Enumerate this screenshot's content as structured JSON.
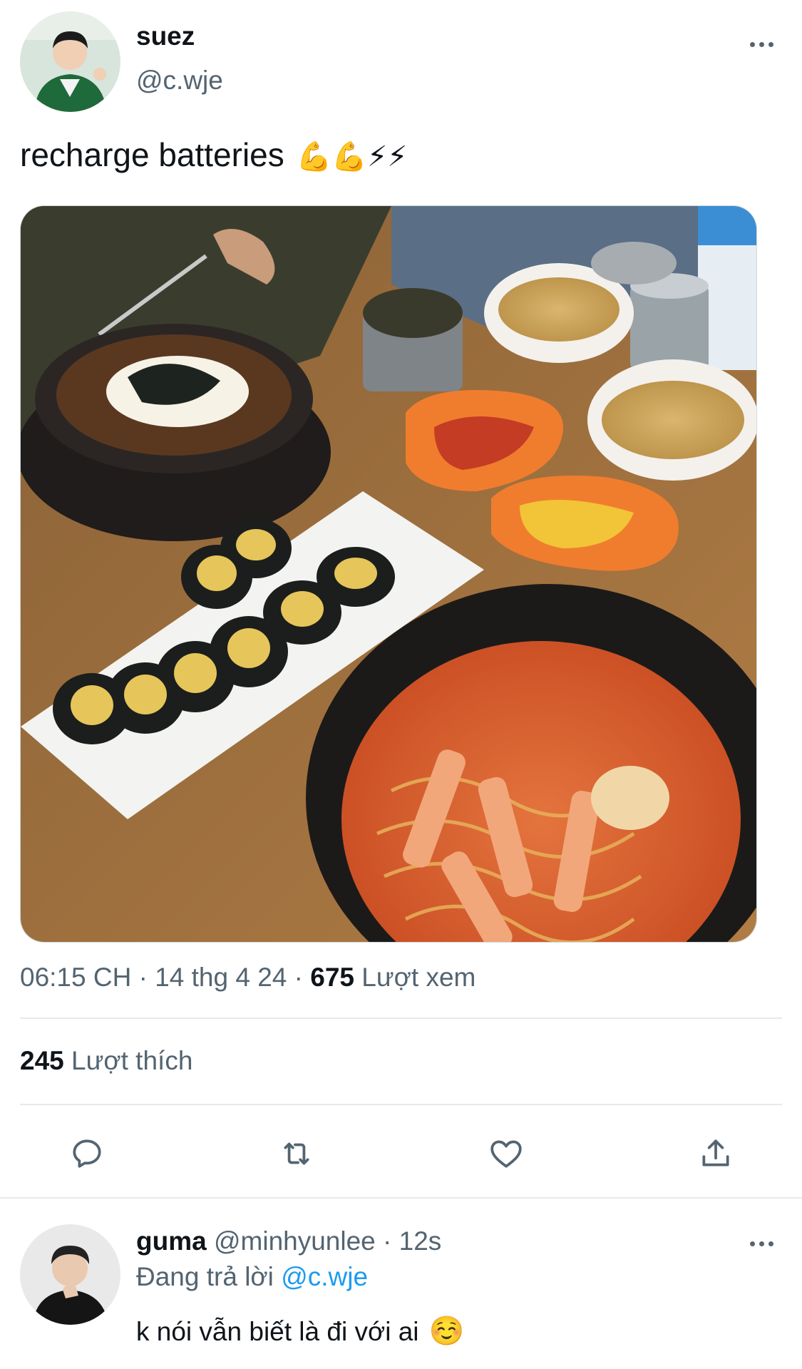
{
  "tweet": {
    "author_name": "suez",
    "author_handle": "@c.wje",
    "text": "recharge batteries",
    "text_emojis": "💪💪⚡⚡",
    "time": "06:15 CH",
    "sep": " · ",
    "date": "14 thg 4 24",
    "views_count": "675",
    "views_label": "Lượt xem",
    "likes_count": "245",
    "likes_label": "Lượt thích"
  },
  "actions": {
    "reply_icon": "reply-icon",
    "retweet_icon": "retweet-icon",
    "like_icon": "heart-icon",
    "share_icon": "share-icon"
  },
  "reply": {
    "author_name": "guma",
    "author_handle": "@minhyunlee",
    "time": "· 12s",
    "replying_label": "Đang trả lời",
    "replying_to": "@c.wje",
    "text": "k nói vẫn biết là đi với ai",
    "text_emoji": "☺️"
  },
  "colors": {
    "text_primary": "#0f1419",
    "text_secondary": "#536471",
    "accent": "#1d9bf0",
    "divider": "#e7e9ea"
  }
}
